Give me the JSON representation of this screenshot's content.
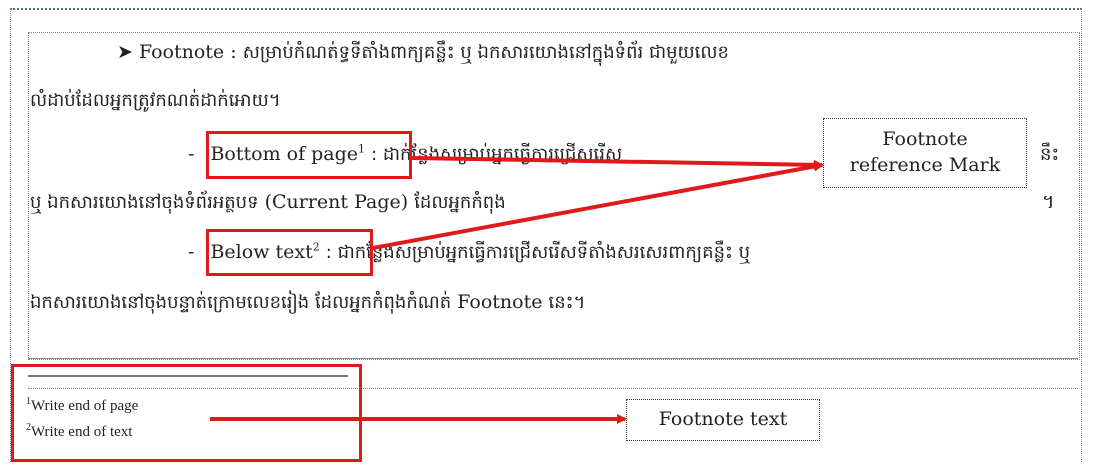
{
  "line1": {
    "arrow": "➤",
    "term": "Footnote",
    "colon": ":",
    "khmer": "សម្រាប់កំណត់ទ្ធទីតាំងពាក្យគន្លឹះ ឬ ឯកសារយោងនៅក្នុងទំព័រ ជាមួយលេខ"
  },
  "line2": "លំដាប់ដែលអ្នកត្រូវកណត់ដាក់អោយ។",
  "item1": {
    "dash": "-",
    "term": "Bottom of page",
    "sup": "1",
    "khmer": ": ដាក់ន្លែងសម្រាប់អ្នកធ្វើការជ្រើសរើស",
    "end": "នឹះ"
  },
  "line4": {
    "khmer_a": "ឬ ឯកសារយោងនៅចុងទំព័រអត្ថបទ",
    "latin": "(Current Page)",
    "khmer_b": "ដែលអ្នកកំពុង",
    "end": "។"
  },
  "item2": {
    "dash": "-",
    "term": "Below text",
    "sup": "2",
    "khmer": ": ជាកន្លែងសម្រាប់អ្នកធ្វើការជ្រើសរើសទីតាំងសរសេរពាក្យគន្លឹះ ឬ"
  },
  "line6": {
    "khmer_a": "ឯកសារយោងនៅចុងបន្ទាត់ក្រោមលេខរៀង ដែលអ្នកកំពុងកំណត់",
    "latin": "Footnote",
    "khmer_b": "នេះ។"
  },
  "callout_mark": {
    "line1": "Footnote",
    "line2": "reference Mark"
  },
  "callout_text": "Footnote text",
  "footnotes": [
    {
      "num": "1",
      "text": "Write  end of page"
    },
    {
      "num": "2",
      "text": "Write  end of text"
    }
  ],
  "colors": {
    "annotation": "#e0191b"
  }
}
